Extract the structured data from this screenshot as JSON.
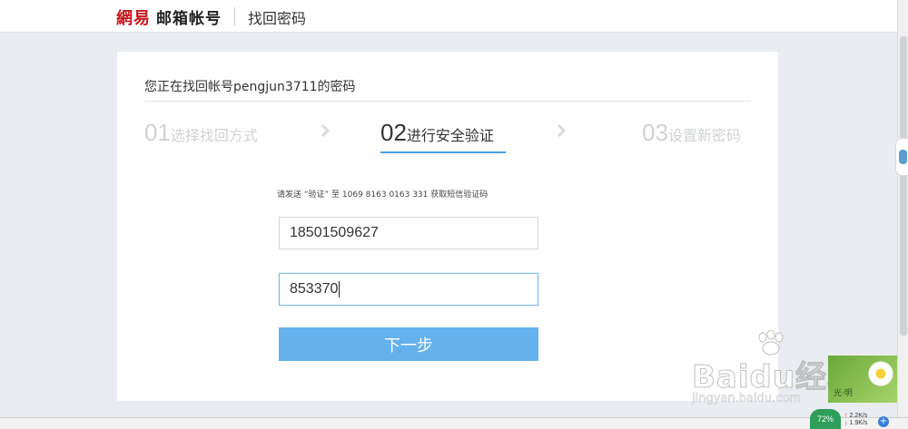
{
  "header": {
    "logo_mark": "網易",
    "logo_text": "邮箱帐号",
    "page_title": "找回密码"
  },
  "main": {
    "heading": "您正在找回帐号pengjun3711的密码",
    "steps": [
      {
        "num": "01",
        "label": "选择找回方式",
        "state": "inactive"
      },
      {
        "num": "02",
        "label": "进行安全验证",
        "state": "active"
      },
      {
        "num": "03",
        "label": "设置新密码",
        "state": "inactive"
      }
    ],
    "hint": "请发送 “验证” 至 1069 8163 0163 331 获取短信验证码",
    "phone_value": "18501509627",
    "code_value": "853370",
    "next_label": "下一步"
  },
  "colors": {
    "accent": "#4a9fe0",
    "button": "#64b1ee",
    "inactive_step": "#cfd2d5"
  },
  "watermark": {
    "main": "Baidu经验",
    "sub": "jingyan.baidu.com"
  },
  "flower_widget": {
    "text": "光·明"
  },
  "status": {
    "speed_percent": "72%",
    "upload": "2.2K/s",
    "download": "1.9K/s"
  }
}
